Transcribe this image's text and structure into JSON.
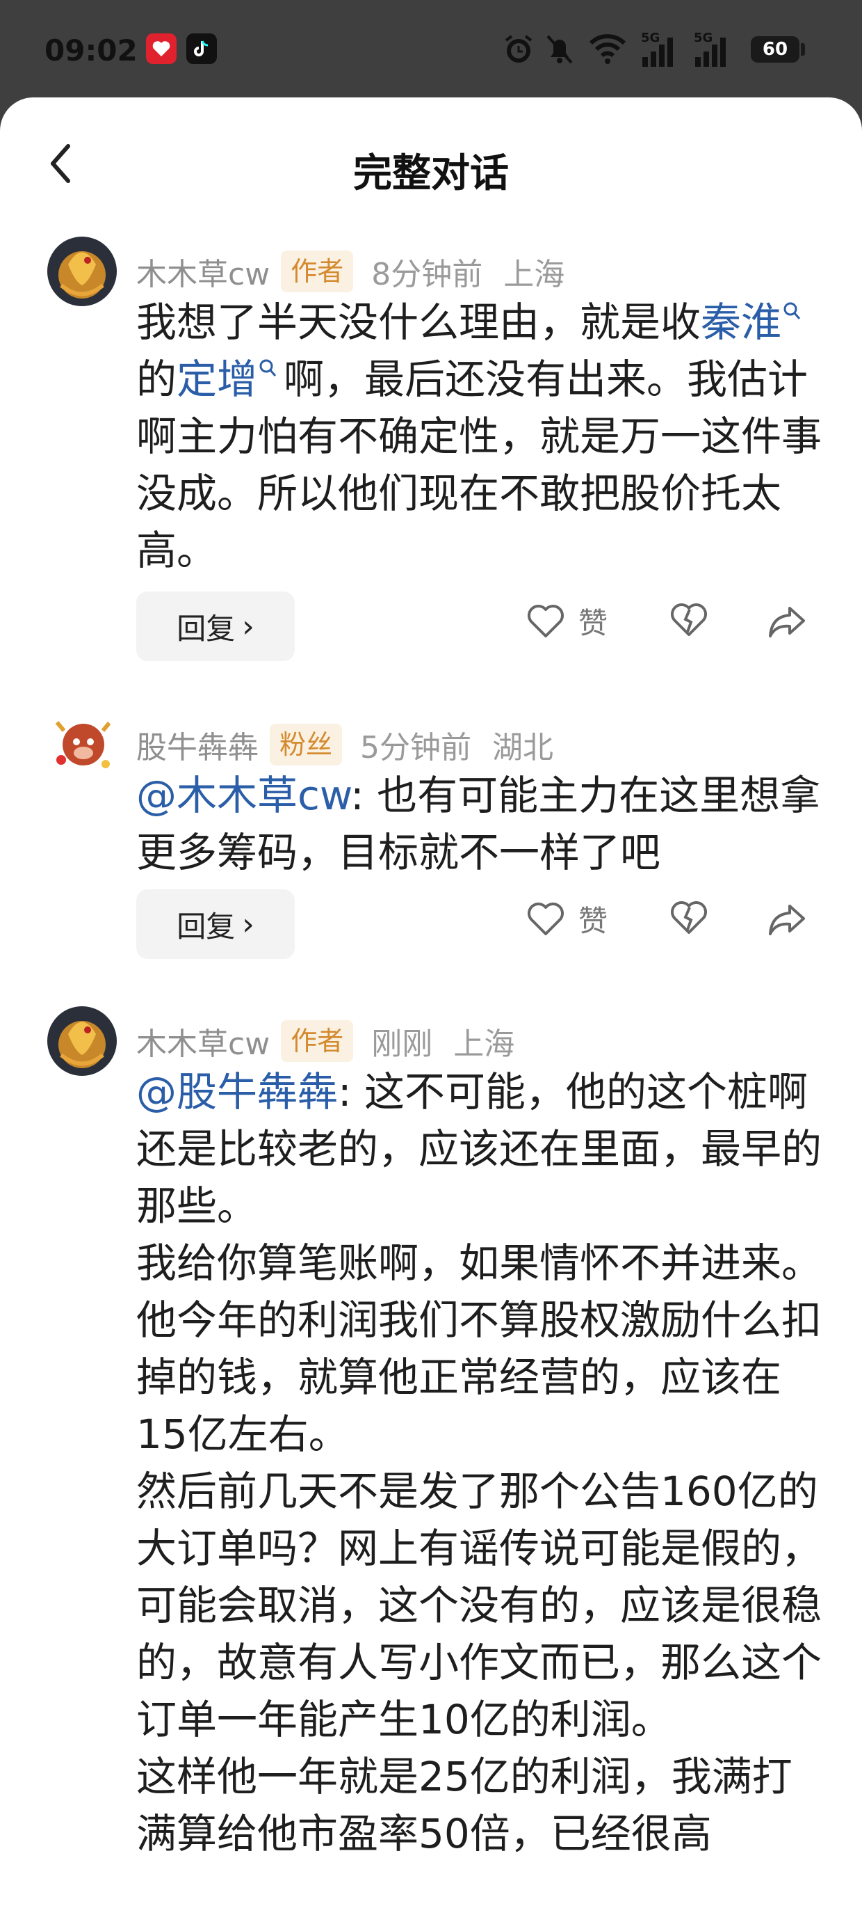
{
  "status_bar": {
    "time": "09:02",
    "battery": "60"
  },
  "page": {
    "title": "完整对话"
  },
  "comments": [
    {
      "name": "木木草cw",
      "badge": "作者",
      "time": "8分钟前",
      "location": "上海",
      "text": {
        "t1": "我想了半天没什么理由，就是收",
        "link1": "秦淮",
        "t2": "的",
        "link2": "定增",
        "t3": "啊，最后还没有出来。我估计啊主力怕有不确定性，就是万一这件事没成。所以他们现在不敢把股价托太高。"
      },
      "reply_label": "回复",
      "like_label": "赞"
    },
    {
      "name": "股牛犇犇",
      "badge": "粉丝",
      "time": "5分钟前",
      "location": "湖北",
      "text": {
        "mention": "@木木草cw",
        "t1": ": 也有可能主力在这里想拿更多筹码，目标就不一样了吧"
      },
      "reply_label": "回复",
      "like_label": "赞"
    },
    {
      "name": "木木草cw",
      "badge": "作者",
      "time": "刚刚",
      "location": "上海",
      "text": {
        "mention": "@股牛犇犇",
        "p1": ": 这不可能，他的这个桩啊还是比较老的，应该还在里面，最早的那些。",
        "p2": "我给你算笔账啊，如果情怀不并进来。",
        "p3": "他今年的利润我们不算股权激励什么扣掉的钱，就算他正常经营的，应该在15亿左右。",
        "p4": "然后前几天不是发了那个公告160亿的大订单吗？网上有谣传说可能是假的，可能会取消，这个没有的，应该是很稳的，故意有人写小作文而已，那么这个订单一年能产生10亿的利润。",
        "p5": "这样他一年就是25亿的利润，我满打满算给他市盈率50倍，已经很高"
      }
    }
  ],
  "colors": {
    "link": "#2b5ea8",
    "badge_bg": "#fbf1e3",
    "badge_text": "#d48a2e"
  }
}
